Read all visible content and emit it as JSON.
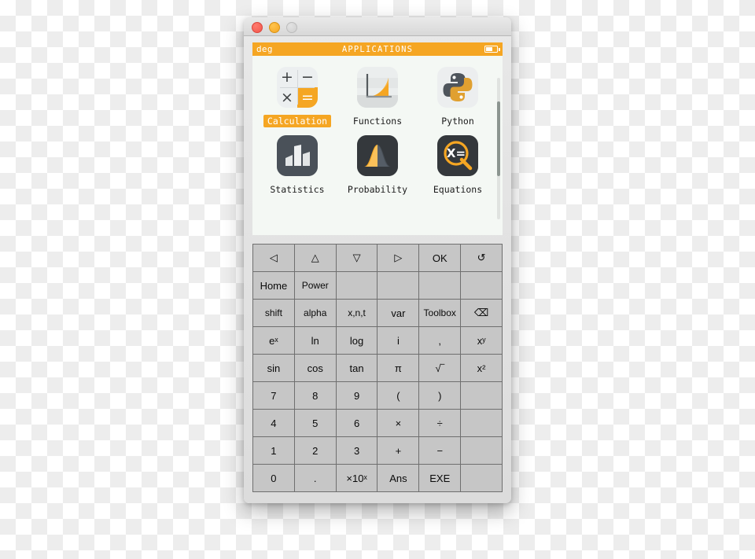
{
  "window": {
    "traffic_lights": [
      {
        "name": "close",
        "color": "#f2554a"
      },
      {
        "name": "minimize",
        "color": "#f5a623"
      },
      {
        "name": "zoom",
        "color": "#cfcfcf"
      }
    ]
  },
  "screen": {
    "status": {
      "left_label": "deg",
      "title": "APPLICATIONS",
      "battery_icon": "battery-icon"
    },
    "apps": [
      [
        {
          "label": "Calculation",
          "icon": "calculation-icon",
          "selected": true,
          "glyphs": [
            "+",
            "−",
            "×",
            "="
          ]
        },
        {
          "label": "Functions",
          "icon": "functions-icon",
          "selected": false
        },
        {
          "label": "Python",
          "icon": "python-icon",
          "selected": false
        }
      ],
      [
        {
          "label": "Statistics",
          "icon": "statistics-icon",
          "selected": false
        },
        {
          "label": "Probability",
          "icon": "probability-icon",
          "selected": false
        },
        {
          "label": "Equations",
          "icon": "equations-icon",
          "selected": false,
          "glyph": "X="
        }
      ]
    ]
  },
  "keypad": {
    "rows": [
      [
        {
          "label": "◁",
          "name": "key-left",
          "empty": false
        },
        {
          "label": "△",
          "name": "key-up",
          "empty": false
        },
        {
          "label": "▽",
          "name": "key-down",
          "empty": false
        },
        {
          "label": "▷",
          "name": "key-right",
          "empty": false
        },
        {
          "label": "OK",
          "name": "key-ok",
          "empty": false
        },
        {
          "label": "↺",
          "name": "key-back",
          "empty": false
        }
      ],
      [
        {
          "label": "Home",
          "name": "key-home",
          "empty": false
        },
        {
          "label": "Power",
          "name": "key-power",
          "empty": false
        },
        {
          "label": "",
          "name": "key-blank-1",
          "empty": true
        },
        {
          "label": "",
          "name": "key-blank-2",
          "empty": true
        },
        {
          "label": "",
          "name": "key-blank-3",
          "empty": true
        },
        {
          "label": "",
          "name": "key-blank-4",
          "empty": true
        }
      ],
      [
        {
          "label": "shift",
          "name": "key-shift",
          "empty": false
        },
        {
          "label": "alpha",
          "name": "key-alpha",
          "empty": false
        },
        {
          "label": "x,n,t",
          "name": "key-xnt",
          "empty": false
        },
        {
          "label": "var",
          "name": "key-var",
          "empty": false
        },
        {
          "label": "Toolbox",
          "name": "key-toolbox",
          "empty": false
        },
        {
          "label": "⌫",
          "name": "key-backspace",
          "empty": false
        }
      ],
      [
        {
          "label": "eˣ",
          "name": "key-exp",
          "empty": false
        },
        {
          "label": "ln",
          "name": "key-ln",
          "empty": false
        },
        {
          "label": "log",
          "name": "key-log",
          "empty": false
        },
        {
          "label": "i",
          "name": "key-i",
          "empty": false
        },
        {
          "label": ",",
          "name": "key-comma",
          "empty": false
        },
        {
          "label": "xʸ",
          "name": "key-power-xy",
          "empty": false
        }
      ],
      [
        {
          "label": "sin",
          "name": "key-sin",
          "empty": false
        },
        {
          "label": "cos",
          "name": "key-cos",
          "empty": false
        },
        {
          "label": "tan",
          "name": "key-tan",
          "empty": false
        },
        {
          "label": "π",
          "name": "key-pi",
          "empty": false
        },
        {
          "label": "√‾",
          "name": "key-sqrt",
          "empty": false
        },
        {
          "label": "x²",
          "name": "key-square",
          "empty": false
        }
      ],
      [
        {
          "label": "7",
          "name": "key-7",
          "empty": false
        },
        {
          "label": "8",
          "name": "key-8",
          "empty": false
        },
        {
          "label": "9",
          "name": "key-9",
          "empty": false
        },
        {
          "label": "(",
          "name": "key-paren-open",
          "empty": false
        },
        {
          "label": ")",
          "name": "key-paren-close",
          "empty": false
        },
        {
          "label": "",
          "name": "key-blank-5",
          "empty": true
        }
      ],
      [
        {
          "label": "4",
          "name": "key-4",
          "empty": false
        },
        {
          "label": "5",
          "name": "key-5",
          "empty": false
        },
        {
          "label": "6",
          "name": "key-6",
          "empty": false
        },
        {
          "label": "×",
          "name": "key-multiply",
          "empty": false
        },
        {
          "label": "÷",
          "name": "key-divide",
          "empty": false
        },
        {
          "label": "",
          "name": "key-blank-6",
          "empty": true
        }
      ],
      [
        {
          "label": "1",
          "name": "key-1",
          "empty": false
        },
        {
          "label": "2",
          "name": "key-2",
          "empty": false
        },
        {
          "label": "3",
          "name": "key-3",
          "empty": false
        },
        {
          "label": "+",
          "name": "key-plus",
          "empty": false
        },
        {
          "label": "−",
          "name": "key-minus",
          "empty": false
        },
        {
          "label": "",
          "name": "key-blank-7",
          "empty": true
        }
      ],
      [
        {
          "label": "0",
          "name": "key-0",
          "empty": false
        },
        {
          "label": ".",
          "name": "key-dot",
          "empty": false
        },
        {
          "label": "×10ˣ",
          "name": "key-exponent",
          "empty": false
        },
        {
          "label": "Ans",
          "name": "key-ans",
          "empty": false
        },
        {
          "label": "EXE",
          "name": "key-exe",
          "empty": false
        },
        {
          "label": "",
          "name": "key-blank-8",
          "empty": true
        }
      ]
    ]
  },
  "colors": {
    "accent": "#f5a623",
    "screen_bg": "#f4f8f4",
    "key_bg": "#c6c6c6",
    "icon_dark": "#4a5159",
    "icon_darker": "#34383c"
  }
}
